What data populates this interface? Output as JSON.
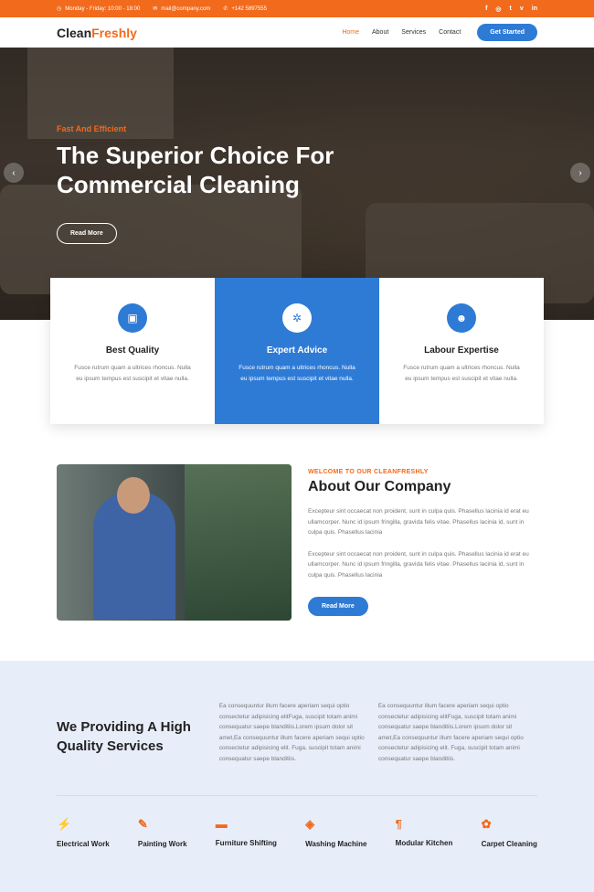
{
  "topbar": {
    "hours": "Monday - Friday: 10:00 - 18:00",
    "email": "mail@company.com",
    "phone": "+142 5897555",
    "social": [
      "f",
      "◎",
      "t",
      "v",
      "in"
    ]
  },
  "nav": {
    "logo_a": "Clean",
    "logo_b": "Freshly",
    "items": [
      "Home",
      "About",
      "Services",
      "Contact"
    ],
    "cta": "Get Started"
  },
  "hero": {
    "kicker": "Fast And Efficient",
    "title_line1": "The Superior Choice For",
    "title_line2": "Commercial Cleaning",
    "button": "Read More"
  },
  "features": [
    {
      "title": "Best Quality",
      "text": "Fusce rutrum quam a ultrices rhoncus. Nulla eu ipsum tempus est suscipit et vitae nulla."
    },
    {
      "title": "Expert Advice",
      "text": "Fusce rutrum quam a ultrices rhoncus. Nulla eu ipsum tempus est suscipit et vitae nulla."
    },
    {
      "title": "Labour Expertise",
      "text": "Fusce rutrum quam a ultrices rhoncus. Nulla eu ipsum tempus est suscipit et vitae nulla."
    }
  ],
  "about": {
    "kicker": "WELCOME TO OUR CLEANFRESHLY",
    "title": "About Our Company",
    "p1": "Excepteur sint occaecat non proident, sunt in culpa quis. Phasellus lacinia id erat eu ullamcorper. Nunc id ipsum fringilla, gravida felis vitae. Phasellus lacinia id, sunt in culpa quis. Phasellus lacinia",
    "p2": "Excepteur sint occaecat non proident, sunt in culpa quis. Phasellus lacinia id erat eu ullamcorper. Nunc id ipsum fringilla, gravida felis vitae. Phasellus lacinia id, sunt in culpa quis. Phasellus lacinia",
    "button": "Read More"
  },
  "services": {
    "title": "We Providing A High Quality Services",
    "p1": "Ea consequuntur illum facere aperiam sequi optio consectetur adipisicing elitFuga, suscipit totam animi consequatur saepe blanditiis.Lorem ipsum dolor sit amet,Ea consequuntur illum facere aperiam sequi optio consectetur adipisicing elit. Fuga, suscipit totam animi consequatur saepe blanditiis.",
    "p2": "Ea consequuntur illum facere aperiam sequi optio consectetur adipisicing elitFuga, suscipit totam animi consequatur saepe blanditiis.Lorem ipsum dolor sit amet,Ea consequuntur illum facere aperiam sequi optio consectetur adipisicing elit. Fuga, suscipit totam animi consequatur saepe blanditiis.",
    "items": [
      {
        "label": "Electrical Work",
        "icon": "plug-icon"
      },
      {
        "label": "Painting Work",
        "icon": "paint-brush-icon"
      },
      {
        "label": "Furniture Shifting",
        "icon": "bed-icon"
      },
      {
        "label": "Washing Machine",
        "icon": "shield-icon"
      },
      {
        "label": "Modular Kitchen",
        "icon": "pilcrow-icon"
      },
      {
        "label": "Carpet Cleaning",
        "icon": "spray-icon"
      }
    ]
  },
  "colors": {
    "accent": "#f26a1b",
    "primary": "#2e7bd6",
    "section_bg": "#e8eef9"
  }
}
